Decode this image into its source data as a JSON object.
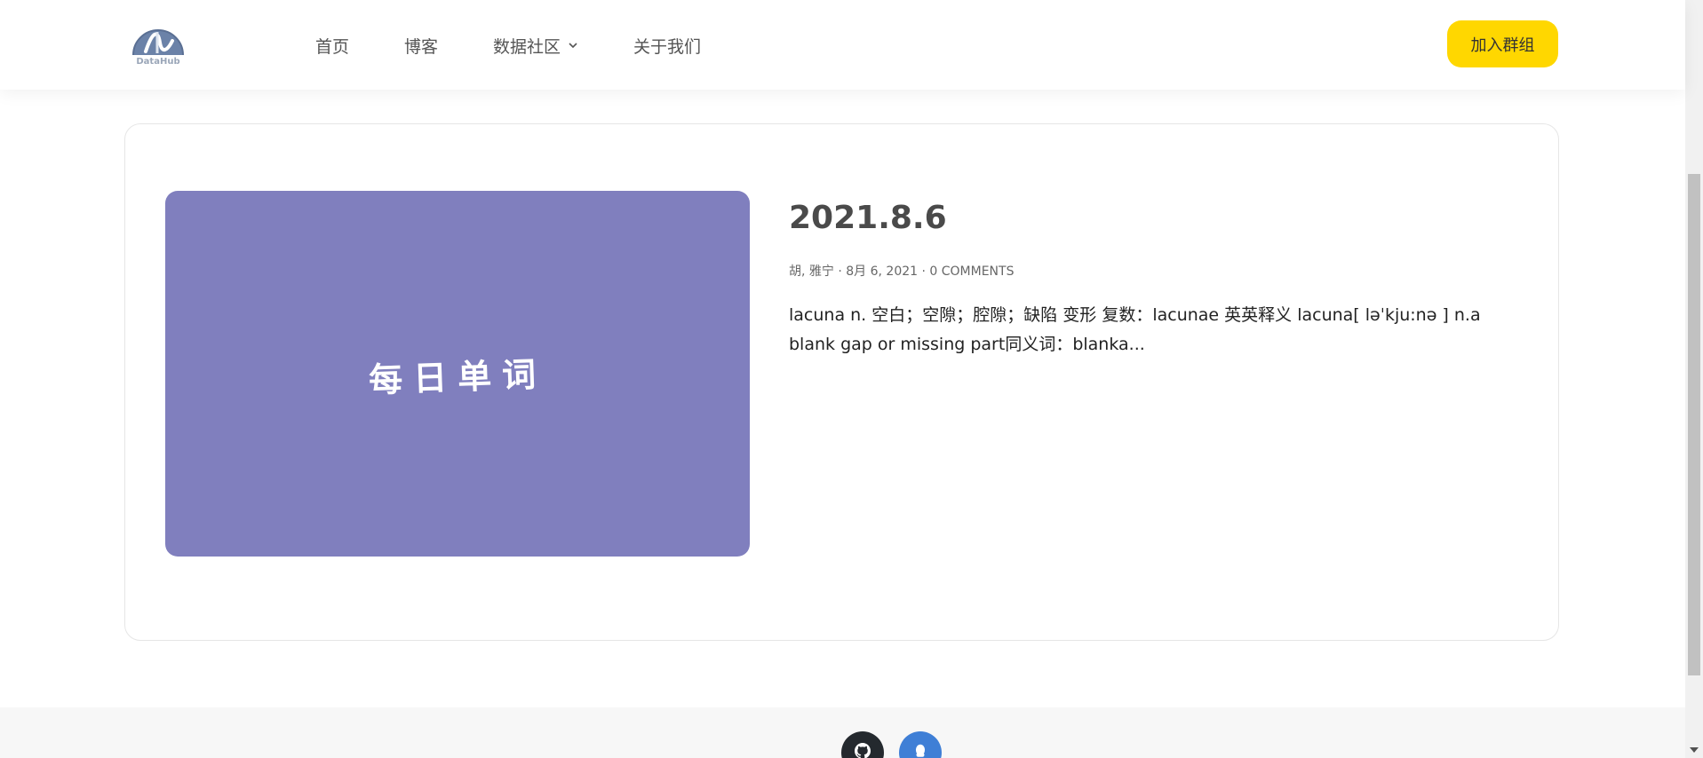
{
  "header": {
    "logo_text": "DataHub",
    "nav": [
      {
        "label": "首页"
      },
      {
        "label": "博客"
      },
      {
        "label": "数据社区"
      },
      {
        "label": "关于我们"
      }
    ],
    "join_button": "加入群组"
  },
  "post": {
    "thumbnail_text": "每日单词",
    "thumbnail_color": "#807fbe",
    "title": "2021.8.6",
    "meta": "胡, 雅宁 · 8月 6, 2021 · 0 COMMENTS",
    "excerpt": "lacuna n. 空白；空隙；腔隙；缺陷 变形 复数：lacunae 英英释义 lacuna[ ləˈkju:nə ] n.a blank gap or missing part同义词：blanka..."
  },
  "footer": {
    "social": [
      {
        "icon": "github-icon",
        "color": "#24292e"
      },
      {
        "icon": "qq-icon",
        "color": "#3f7fd6"
      }
    ]
  },
  "colors": {
    "accent": "#ffd700"
  }
}
